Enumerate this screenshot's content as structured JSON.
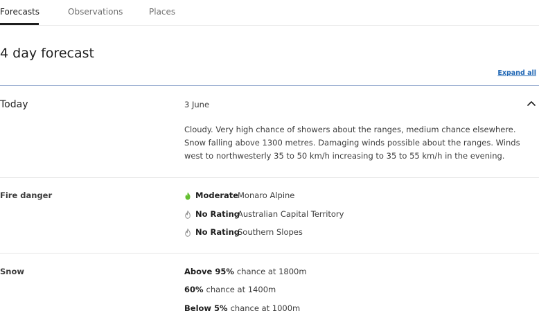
{
  "tabs": [
    {
      "label": "Forecasts",
      "active": true
    },
    {
      "label": "Observations",
      "active": false
    },
    {
      "label": "Places",
      "active": false
    }
  ],
  "page_title": "4 day forecast",
  "expand_all_label": "Expand all",
  "today": {
    "label": "Today",
    "date": "3 June",
    "chevron_icon": "chevron-up-icon",
    "forecast_text": "Cloudy. Very high chance of showers about the ranges, medium chance elsewhere. Snow falling above 1300 metres. Damaging winds possible about the ranges. Winds west to northwesterly 35 to 50 km/h increasing to 35 to 55 km/h in the evening."
  },
  "fire_danger": {
    "label": "Fire danger",
    "rows": [
      {
        "rating": "Moderate",
        "area": "Monaro Alpine",
        "icon": "fire-danger-moderate-icon",
        "color": "#64bf30"
      },
      {
        "rating": "No Rating",
        "area": "Australian Capital Territory",
        "icon": "fire-danger-no-rating-icon",
        "color": "#8a8a8a"
      },
      {
        "rating": "No Rating",
        "area": "Southern Slopes",
        "icon": "fire-danger-no-rating-icon",
        "color": "#8a8a8a"
      }
    ]
  },
  "snow": {
    "label": "Snow",
    "rows": [
      {
        "pct": "Above 95%",
        "rest": "chance at 1800m"
      },
      {
        "pct": "60%",
        "rest": "chance at 1400m"
      },
      {
        "pct": "Below 5%",
        "rest": "chance at 1000m"
      }
    ]
  },
  "colors": {
    "link": "#1f66b4",
    "moderate": "#64bf30",
    "no_rating": "#8a8a8a"
  }
}
